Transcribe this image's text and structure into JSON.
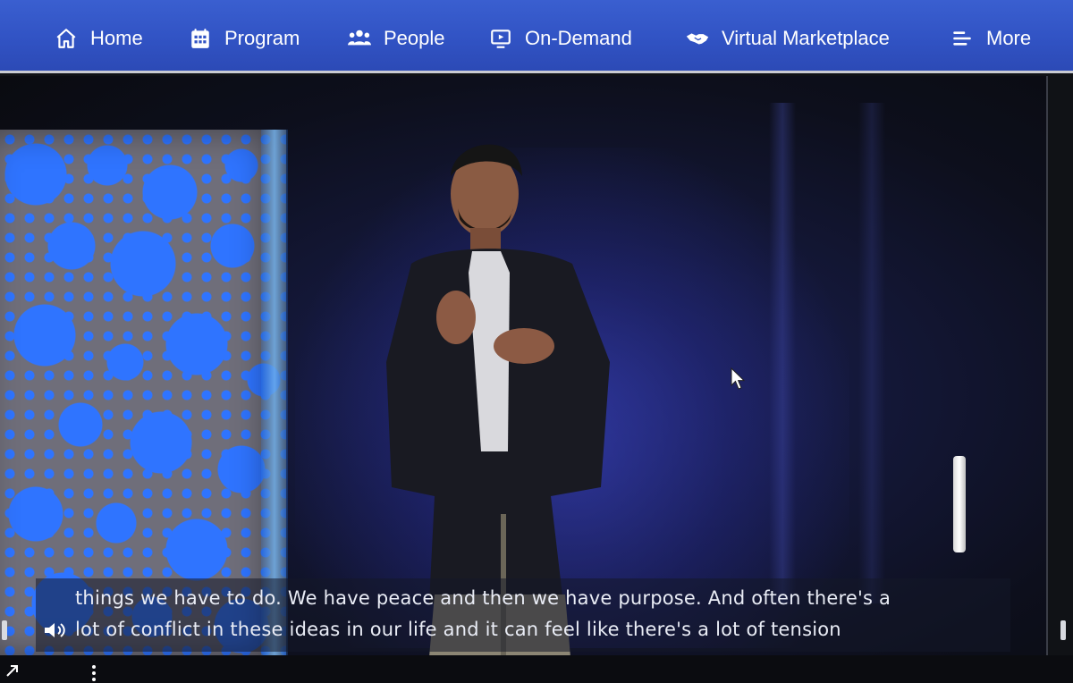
{
  "nav": {
    "items": [
      {
        "label": "Home",
        "icon": "home-icon"
      },
      {
        "label": "Program",
        "icon": "calendar-icon"
      },
      {
        "label": "People",
        "icon": "people-icon"
      },
      {
        "label": "On-Demand",
        "icon": "video-play-icon"
      },
      {
        "label": "Virtual Marketplace",
        "icon": "handshake-icon"
      },
      {
        "label": "More",
        "icon": "menu-lines-icon"
      }
    ]
  },
  "video": {
    "captions": {
      "line1": "things we have to do.  We have peace and then we have purpose.  And often there's a",
      "line2": "lot of conflict in these ideas in our life and it can feel like there's a lot of tension"
    }
  },
  "colors": {
    "nav_background": "#3153c4",
    "caption_text": "#e9ecf5",
    "stage_accent": "#2f74ff"
  }
}
